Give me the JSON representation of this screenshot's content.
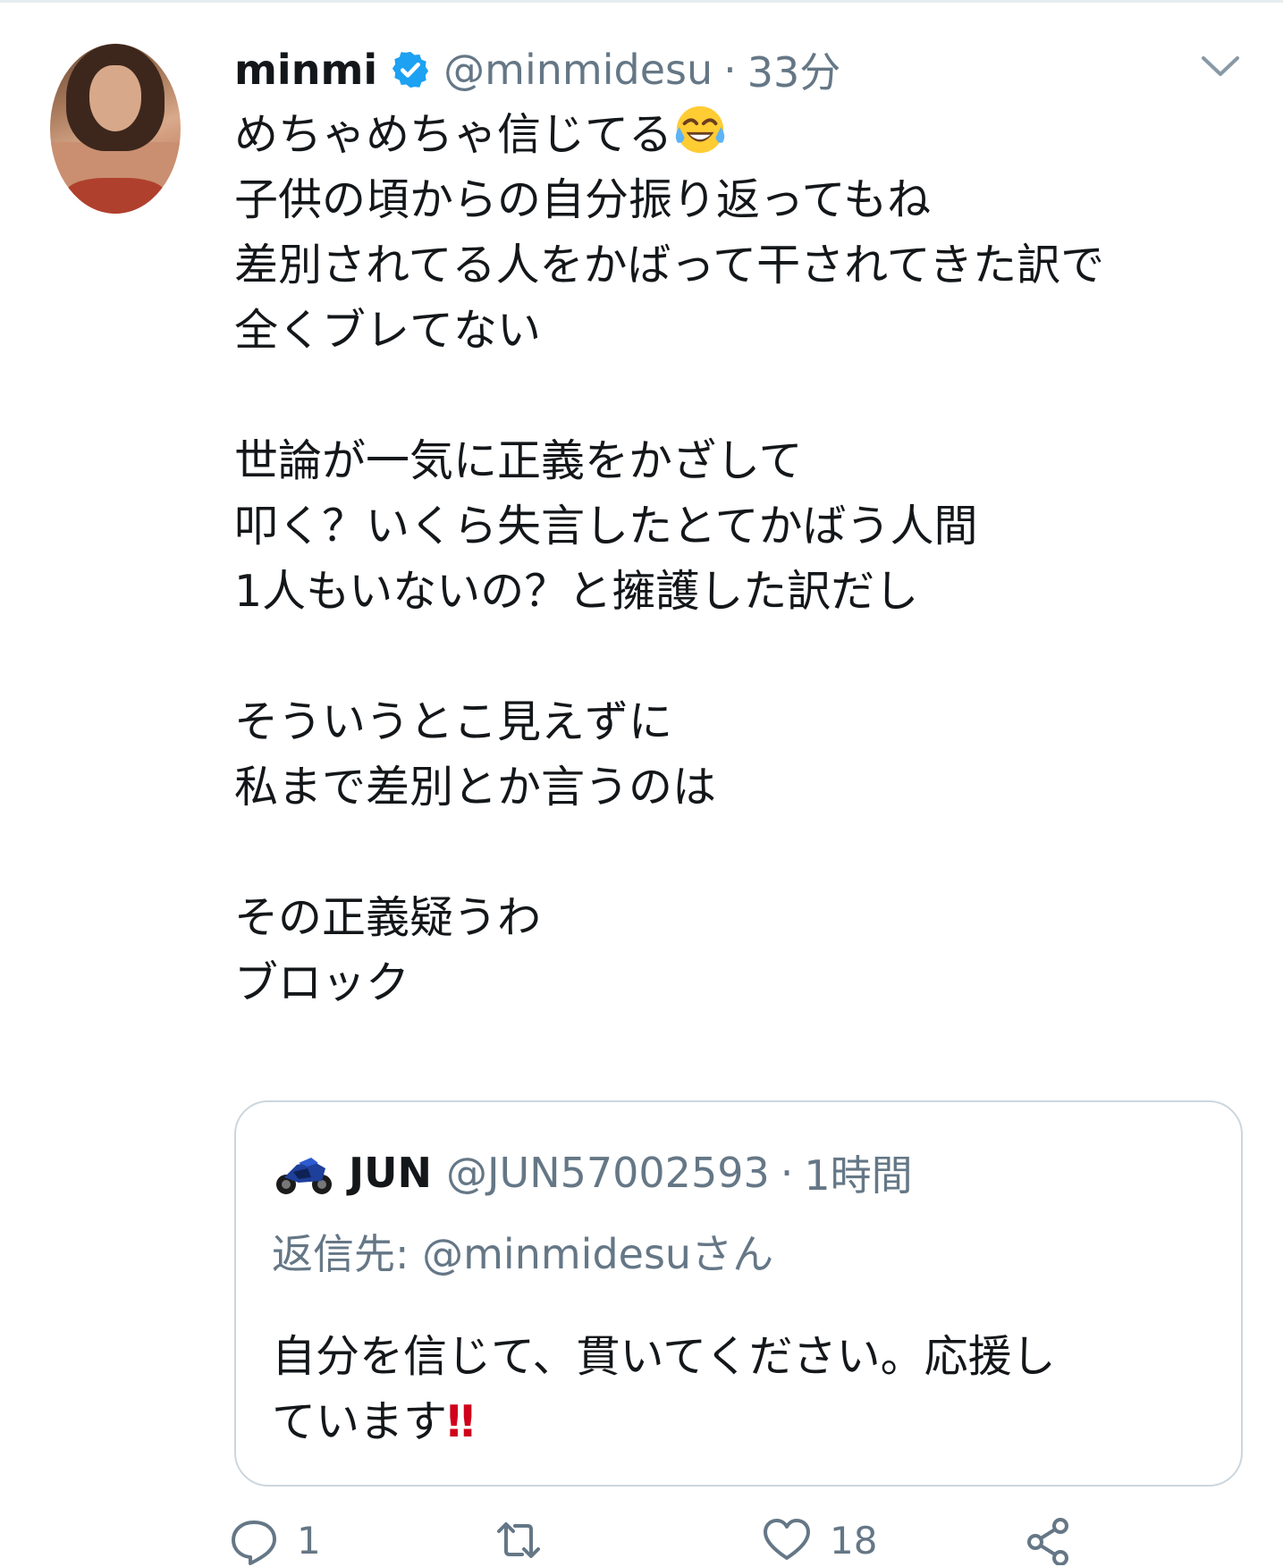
{
  "tweet": {
    "author_name": "minmi",
    "author_handle": "@minmidesu",
    "separator": "·",
    "time": "33分",
    "line1": "めちゃめちゃ信じてる",
    "body_rest": "\n子供の頃からの自分振り返ってもね\n差別されてる人をかばって干されてきた訳で\n全くブレてない\n\n世論が一気に正義をかざして\n叩く？いくら失言したとてかばう人間\n1人もいないの？と擁護した訳だし\n\nそういうとこ見えずに\n私まで差別とか言うのは\n\nその正義疑うわ\nブロック",
    "emoji": "face-with-tears-of-joy"
  },
  "quote": {
    "author_name": "JUN",
    "author_handle": "@JUN57002593",
    "separator": "·",
    "time": "1時間",
    "reply_to": "返信先: @minmidesuさん",
    "text": "自分を信じて、貫いてください。応援し\nています",
    "emphasis": "‼"
  },
  "actions": {
    "reply_count": "1",
    "retweet_count": "",
    "like_count": "18"
  },
  "icons": {
    "verified": "verified-badge-icon",
    "chevron": "chevron-down-icon",
    "reply": "reply-icon",
    "retweet": "retweet-icon",
    "like": "heart-icon",
    "share": "share-icon"
  },
  "colors": {
    "accent": "#1da1f2",
    "secondary_text": "#657786",
    "border": "#ccd6dd",
    "emphasis": "#d0021b"
  }
}
